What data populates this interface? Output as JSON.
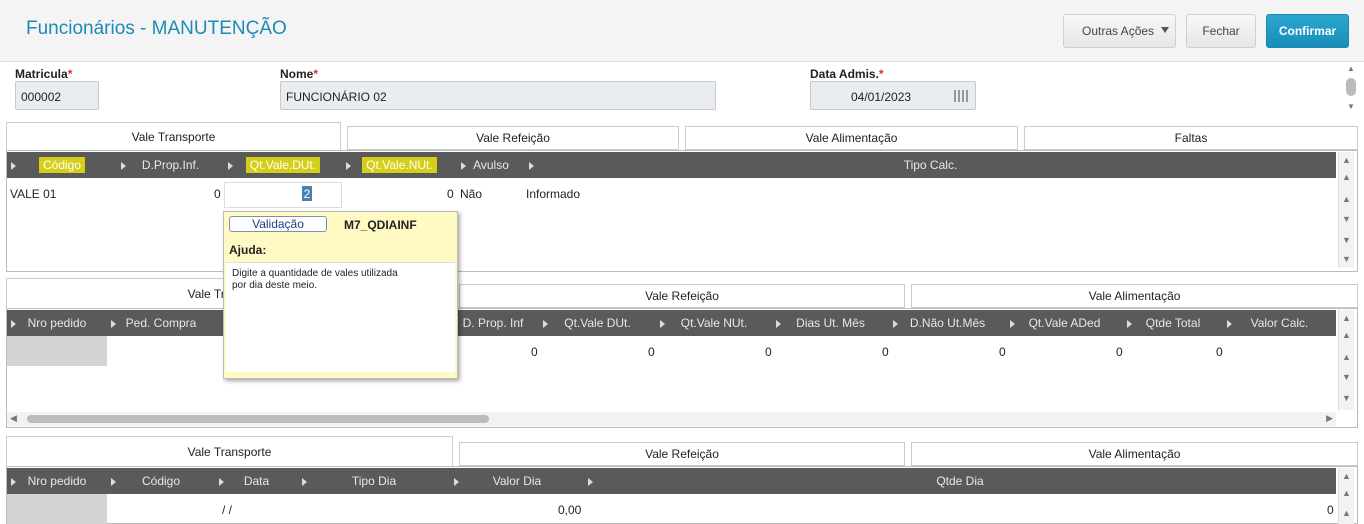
{
  "header": {
    "title": "Funcionários - MANUTENÇÃO",
    "outras_acoes": "Outras Ações",
    "fechar": "Fechar",
    "confirmar": "Confirmar"
  },
  "form": {
    "matricula_label": "Matricula",
    "matricula_value": "000002",
    "nome_label": "Nome",
    "nome_value": "FUNCIONÁRIO 02",
    "data_label": "Data Admis.",
    "data_value": "04/01/2023",
    "required_mark": "*"
  },
  "tabs1": [
    "Vale Transporte",
    "Vale Refeição",
    "Vale Alimentação",
    "Faltas"
  ],
  "grid1": {
    "columns": [
      "Código",
      "D.Prop.Inf.",
      "Qt.Vale.DUt.",
      "Qt.Vale.NUt.",
      "Avulso",
      "Tipo Calc."
    ],
    "row": [
      "VALE 01",
      "0",
      "2",
      "0",
      "Não",
      "Informado"
    ]
  },
  "tabs2": [
    "Vale Transporte",
    "Vale Refeição",
    "Vale Alimentação"
  ],
  "grid2": {
    "columns": [
      "Nro pedido",
      "Ped. Compra",
      "D. Prop. Inf",
      "Qt.Vale DUt.",
      "Qt.Vale NUt.",
      "Dias Ut. Mês",
      "D.Não Ut.Mês",
      "Qt.Vale ADed",
      "Qtde Total",
      "Valor Calc."
    ],
    "row": [
      "0",
      "0",
      "0",
      "0",
      "0",
      "0",
      "0"
    ]
  },
  "tabs3": [
    "Vale Transporte",
    "Vale Refeição",
    "Vale Alimentação"
  ],
  "grid3": {
    "columns": [
      "Nro pedido",
      "Código",
      "Data",
      "Tipo Dia",
      "Valor Dia",
      "Qtde Dia"
    ],
    "row": [
      " /  /",
      "0,00",
      "0"
    ]
  },
  "popup": {
    "validacao": "Validação",
    "code": "M7_QDIAINF",
    "ajuda": "Ajuda:",
    "text_line1": "Digite a quantidade de vales utilizada",
    "text_line2": "por dia deste meio."
  }
}
